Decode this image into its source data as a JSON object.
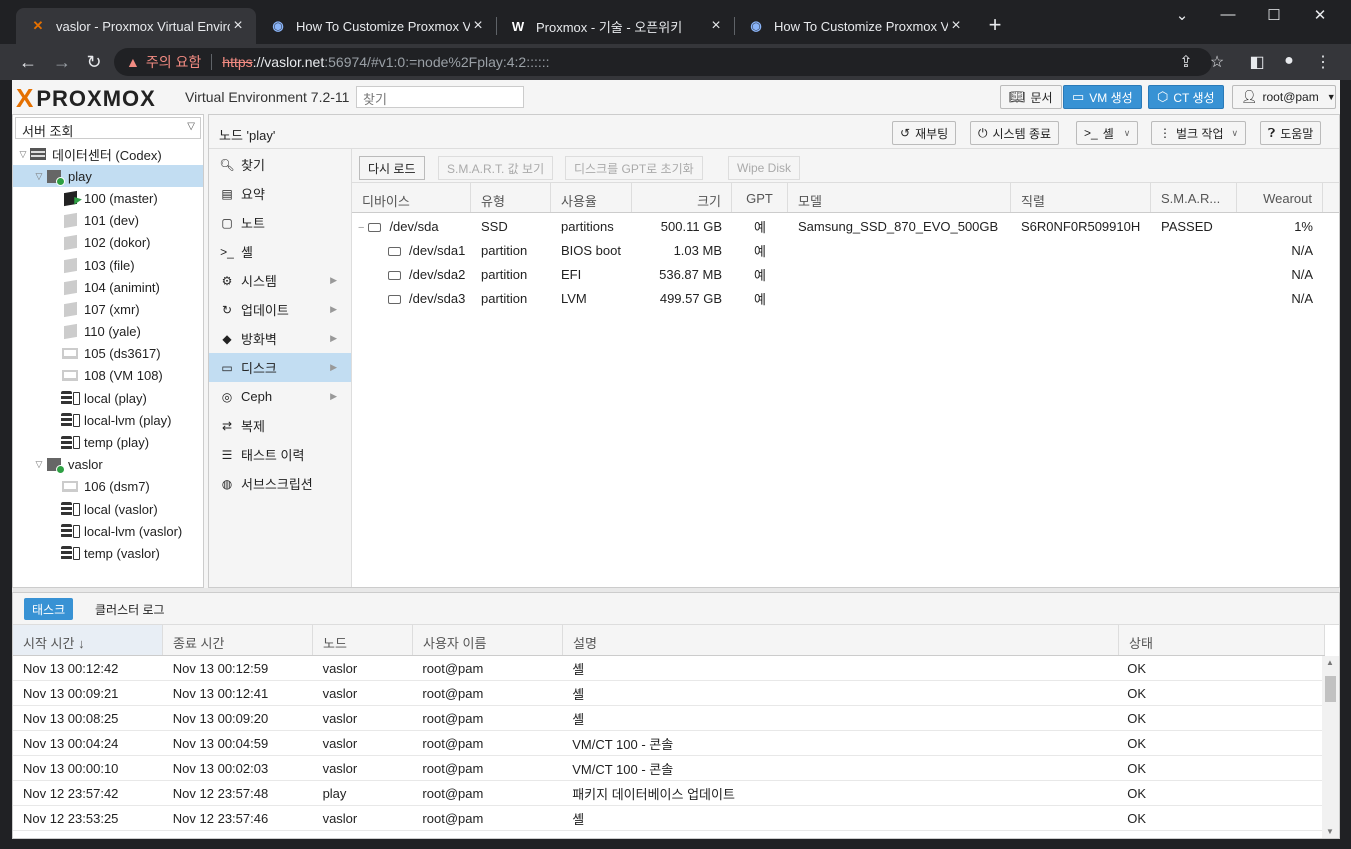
{
  "browser": {
    "tabs": [
      {
        "title": "vaslor - Proxmox Virtual Environ",
        "favicon": "proxmox-x-icon"
      },
      {
        "title": "How To Customize Proxmox VE",
        "favicon": "globe-icon"
      },
      {
        "title": "Proxmox - 기술 - 오픈위키",
        "favicon": "w-icon"
      },
      {
        "title": "How To Customize Proxmox VE",
        "favicon": "globe-icon"
      }
    ],
    "security_warning": "주의 요함",
    "url_scheme": "https",
    "url_host": "://vaslor.net",
    "url_rest": ":56974/#v1:0:=node%2Fplay:4:2::::::"
  },
  "header": {
    "brand": "PROXMOX",
    "version": "Virtual Environment 7.2-11",
    "search_placeholder": "찾기",
    "docs": "문서",
    "create_vm": "VM 생성",
    "create_ct": "CT 생성",
    "user": "root@pam"
  },
  "tree": {
    "view": "서버 조회",
    "nodes": [
      {
        "label": "데이터센터 (Codex)",
        "depth": 0,
        "icon": "datacenter-icon",
        "exp": "▽"
      },
      {
        "label": "play",
        "depth": 1,
        "icon": "node-online-icon",
        "exp": "▽",
        "sel": true
      },
      {
        "label": "100 (master)",
        "depth": 2,
        "icon": "ct-running-icon"
      },
      {
        "label": "101 (dev)",
        "depth": 2,
        "icon": "ct-icon"
      },
      {
        "label": "102 (dokor)",
        "depth": 2,
        "icon": "ct-icon"
      },
      {
        "label": "103 (file)",
        "depth": 2,
        "icon": "ct-icon"
      },
      {
        "label": "104 (animint)",
        "depth": 2,
        "icon": "ct-icon"
      },
      {
        "label": "107 (xmr)",
        "depth": 2,
        "icon": "ct-icon"
      },
      {
        "label": "110 (yale)",
        "depth": 2,
        "icon": "ct-icon"
      },
      {
        "label": "105 (ds3617)",
        "depth": 2,
        "icon": "vm-icon"
      },
      {
        "label": "108 (VM 108)",
        "depth": 2,
        "icon": "vm-icon"
      },
      {
        "label": "local (play)",
        "depth": 2,
        "icon": "storage-icon"
      },
      {
        "label": "local-lvm (play)",
        "depth": 2,
        "icon": "storage-icon"
      },
      {
        "label": "temp (play)",
        "depth": 2,
        "icon": "storage-icon"
      },
      {
        "label": "vaslor",
        "depth": 1,
        "icon": "node-online-icon",
        "exp": "▽"
      },
      {
        "label": "106 (dsm7)",
        "depth": 2,
        "icon": "vm-icon"
      },
      {
        "label": "local (vaslor)",
        "depth": 2,
        "icon": "storage-icon"
      },
      {
        "label": "local-lvm (vaslor)",
        "depth": 2,
        "icon": "storage-icon"
      },
      {
        "label": "temp (vaslor)",
        "depth": 2,
        "icon": "storage-icon"
      }
    ]
  },
  "node_panel": {
    "title": "노드 'play'",
    "reboot": "재부팅",
    "shutdown": "시스템 종료",
    "shell": "셸",
    "bulk": "벌크 작업",
    "help": "도움말"
  },
  "menu": [
    {
      "label": "찾기",
      "icon": "search-icon",
      "glyph": "🔍︎"
    },
    {
      "label": "요약",
      "icon": "summary-icon",
      "glyph": "▤"
    },
    {
      "label": "노트",
      "icon": "notes-icon",
      "glyph": "▢"
    },
    {
      "label": "셸",
      "icon": "terminal-icon",
      "glyph": ">_"
    },
    {
      "label": "시스템",
      "icon": "gears-icon",
      "glyph": "⚙",
      "arrow": true
    },
    {
      "label": "업데이트",
      "icon": "refresh-icon",
      "glyph": "↻",
      "arrow": true
    },
    {
      "label": "방화벽",
      "icon": "shield-icon",
      "glyph": "◆",
      "arrow": true
    },
    {
      "label": "디스크",
      "icon": "hdd-icon",
      "glyph": "▭",
      "arrow": true,
      "sel": true
    },
    {
      "label": "Ceph",
      "icon": "ceph-icon",
      "glyph": "◎",
      "arrow": true
    },
    {
      "label": "복제",
      "icon": "replication-icon",
      "glyph": "⇄"
    },
    {
      "label": "태스트 이력",
      "icon": "list-icon",
      "glyph": "☰"
    },
    {
      "label": "서브스크립션",
      "icon": "support-icon",
      "glyph": "◍"
    }
  ],
  "disks": {
    "reload": "다시 로드",
    "smart": "S.M.A.R.T. 값 보기",
    "init_gpt": "디스크를 GPT로 초기화",
    "wipe": "Wipe Disk",
    "columns": [
      "디바이스",
      "유형",
      "사용율",
      "크기",
      "GPT",
      "모델",
      "직렬",
      "S.M.A.R...",
      "Wearout"
    ],
    "rows": [
      {
        "device": "/dev/sda",
        "type": "SSD",
        "usage": "partitions",
        "size": "500.11 GB",
        "gpt": "예",
        "model": "Samsung_SSD_870_EVO_500GB",
        "serial": "S6R0NF0R509910H",
        "smart": "PASSED",
        "wearout": "1%",
        "child": false
      },
      {
        "device": "/dev/sda1",
        "type": "partition",
        "usage": "BIOS boot",
        "size": "1.03 MB",
        "gpt": "예",
        "model": "",
        "serial": "",
        "smart": "",
        "wearout": "N/A",
        "child": true
      },
      {
        "device": "/dev/sda2",
        "type": "partition",
        "usage": "EFI",
        "size": "536.87 MB",
        "gpt": "예",
        "model": "",
        "serial": "",
        "smart": "",
        "wearout": "N/A",
        "child": true
      },
      {
        "device": "/dev/sda3",
        "type": "partition",
        "usage": "LVM",
        "size": "499.57 GB",
        "gpt": "예",
        "model": "",
        "serial": "",
        "smart": "",
        "wearout": "N/A",
        "child": true
      }
    ]
  },
  "tasks": {
    "tab_tasks": "태스크",
    "tab_cluster_log": "클러스터 로그",
    "columns": [
      "시작 시간 ↓",
      "종료 시간",
      "노드",
      "사용자 이름",
      "설명",
      "상태"
    ],
    "rows": [
      [
        "Nov 13 00:12:42",
        "Nov 13 00:12:59",
        "vaslor",
        "root@pam",
        "셸",
        "OK"
      ],
      [
        "Nov 13 00:09:21",
        "Nov 13 00:12:41",
        "vaslor",
        "root@pam",
        "셸",
        "OK"
      ],
      [
        "Nov 13 00:08:25",
        "Nov 13 00:09:20",
        "vaslor",
        "root@pam",
        "셸",
        "OK"
      ],
      [
        "Nov 13 00:04:24",
        "Nov 13 00:04:59",
        "vaslor",
        "root@pam",
        "VM/CT 100 - 콘솔",
        "OK"
      ],
      [
        "Nov 13 00:00:10",
        "Nov 13 00:02:03",
        "vaslor",
        "root@pam",
        "VM/CT 100 - 콘솔",
        "OK"
      ],
      [
        "Nov 12 23:57:42",
        "Nov 12 23:57:48",
        "play",
        "root@pam",
        "패키지 데이터베이스 업데이트",
        "OK"
      ],
      [
        "Nov 12 23:53:25",
        "Nov 12 23:57:46",
        "vaslor",
        "root@pam",
        "셸",
        "OK"
      ]
    ]
  },
  "colors": {
    "accent": "#3892d4",
    "selected": "#c2ddf2",
    "brand_orange": "#e57000"
  }
}
